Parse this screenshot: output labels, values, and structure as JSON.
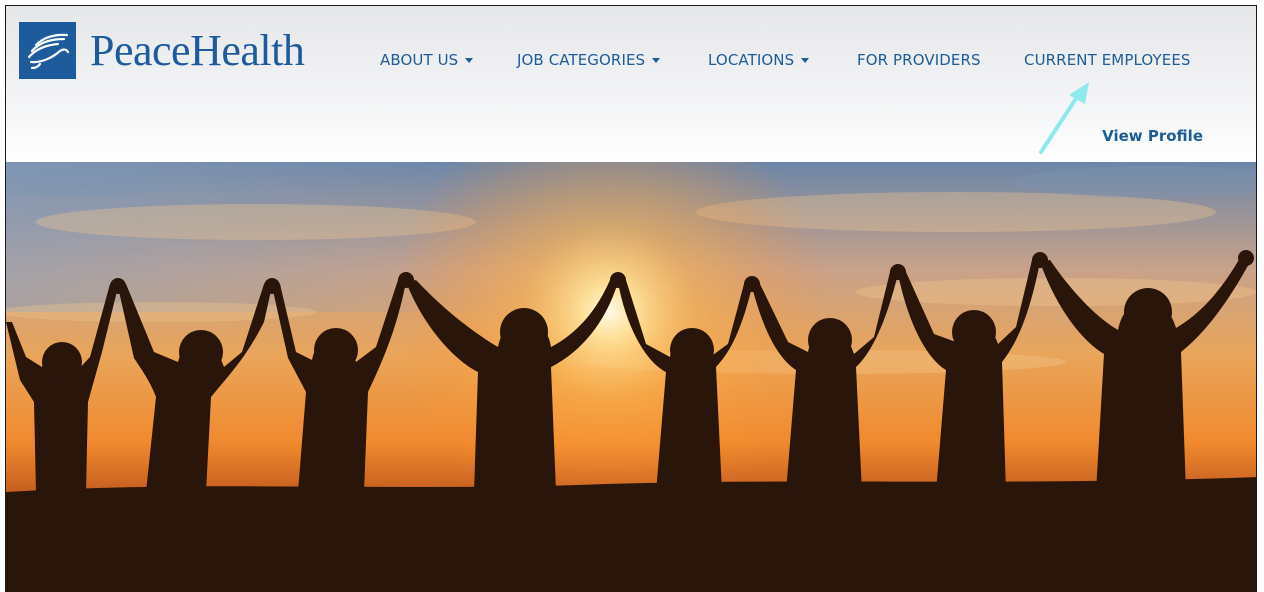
{
  "brand": {
    "name": "PeaceHealth",
    "logo_icon": "dove-icon",
    "color": "#1d5b9c"
  },
  "nav": {
    "items": [
      {
        "label": "ABOUT US",
        "has_dropdown": true
      },
      {
        "label": "JOB CATEGORIES",
        "has_dropdown": true
      },
      {
        "label": "LOCATIONS",
        "has_dropdown": true
      },
      {
        "label": "FOR PROVIDERS",
        "has_dropdown": false
      },
      {
        "label": "CURRENT EMPLOYEES",
        "has_dropdown": false
      }
    ],
    "color": "#1e5c96"
  },
  "account": {
    "view_profile_label": "View Profile"
  },
  "annotation": {
    "type": "arrow",
    "points_to": "CURRENT EMPLOYEES",
    "color": "#7fe3e8"
  },
  "hero": {
    "description_icon": "people-holding-hands-sunset-image"
  }
}
